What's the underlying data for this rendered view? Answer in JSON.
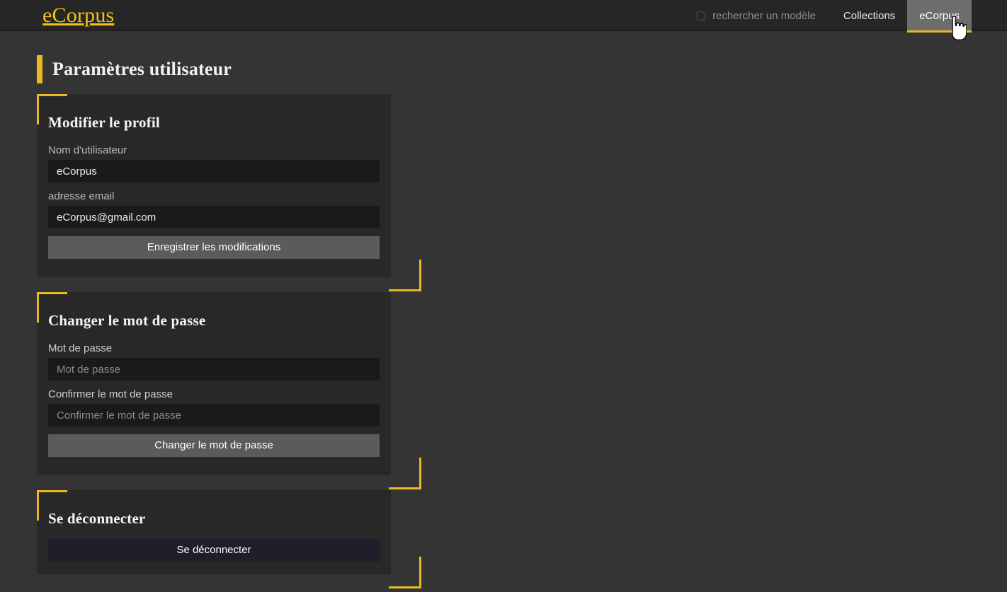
{
  "header": {
    "brand": "eCorpus",
    "search": {
      "icon": "search-icon",
      "placeholder": "rechercher un modèle",
      "value": ""
    },
    "nav": [
      {
        "label": "Collections",
        "active": false
      },
      {
        "label": "eCorpus",
        "active": true
      }
    ]
  },
  "page": {
    "title": "Paramètres utilisateur"
  },
  "cards": {
    "profile": {
      "title": "Modifier le profil",
      "username_label": "Nom d'utilisateur",
      "username_value": "eCorpus",
      "email_label": "adresse email",
      "email_value": "eCorpus@gmail.com",
      "save_button": "Enregistrer les modifications"
    },
    "password": {
      "title": "Changer le mot de passe",
      "password_label": "Mot de passe",
      "password_placeholder": "Mot de passe",
      "password_value": "",
      "confirm_label": "Confirmer le mot de passe",
      "confirm_placeholder": "Confirmer le mot de passe",
      "confirm_value": "",
      "change_button": "Changer le mot de passe"
    },
    "logout": {
      "title": "Se déconnecter",
      "logout_button": "Se déconnecter"
    }
  },
  "colors": {
    "accent": "#e8b923",
    "brand": "#f1c40f",
    "page_bg": "#343434",
    "header_bg": "#262626",
    "card_bg": "#282828",
    "input_bg": "#1a1a1a",
    "button_gray": "#5b5b5b",
    "button_logout": "#201e2b",
    "active_tab_bg": "#6d6d6d"
  }
}
